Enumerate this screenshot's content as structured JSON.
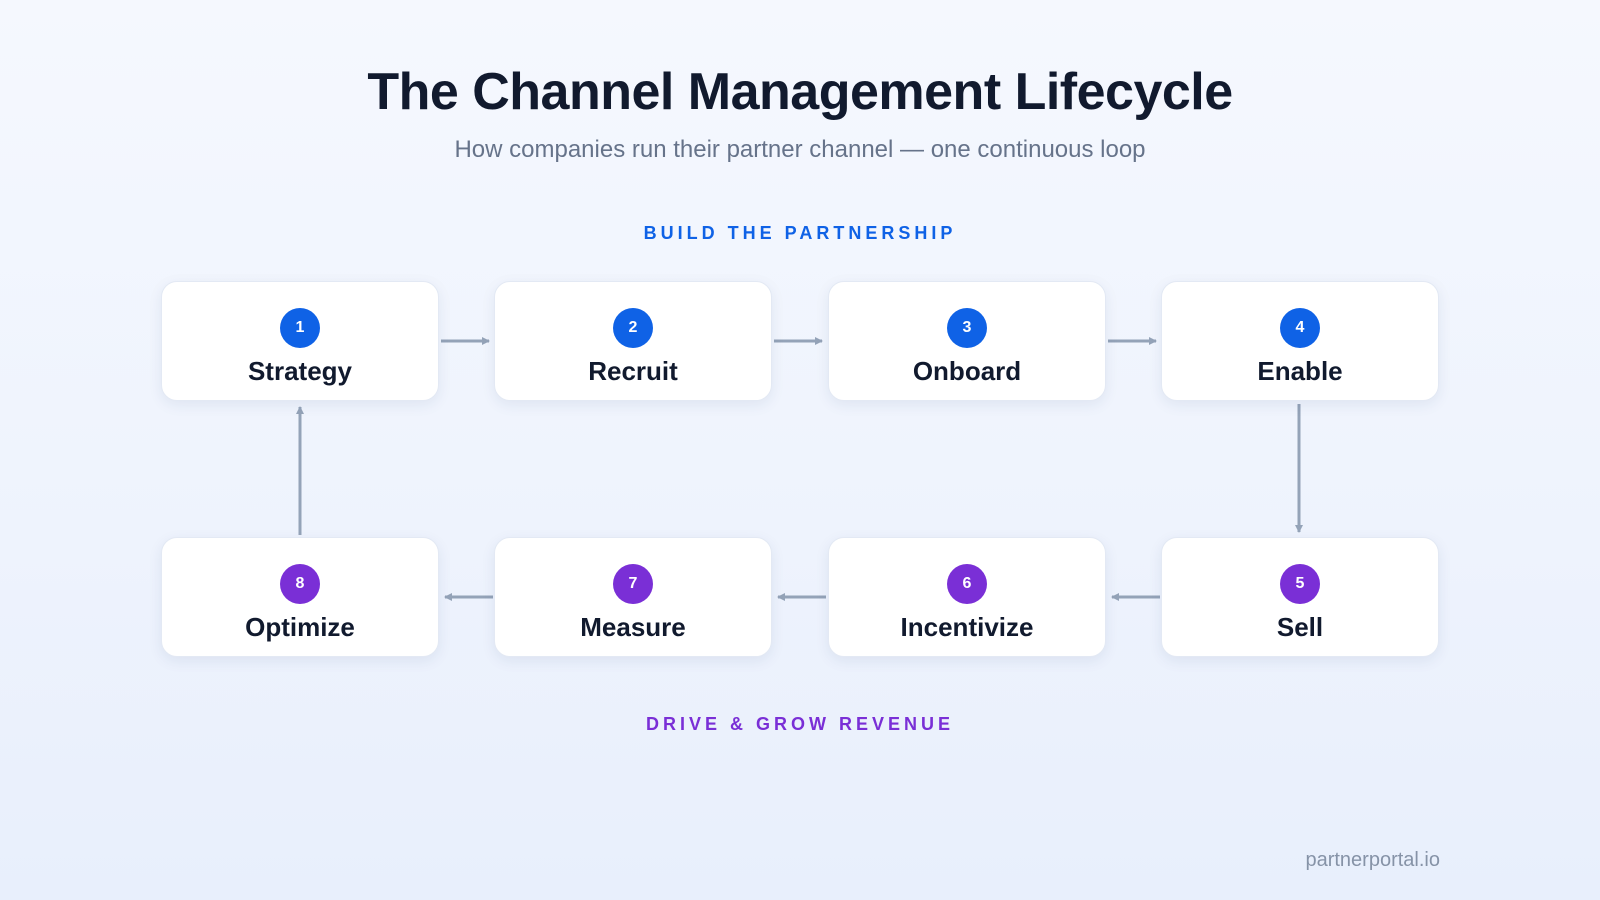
{
  "title": "The Channel Management Lifecycle",
  "subtitle": "How companies run their partner channel — one continuous loop",
  "phases": {
    "top": {
      "label": "BUILD THE PARTNERSHIP",
      "color": "#0f62e6"
    },
    "bottom": {
      "label": "DRIVE & GROW REVENUE",
      "color": "#7a2fd6"
    }
  },
  "steps": [
    {
      "number": "1",
      "name": "Strategy",
      "phase": "top"
    },
    {
      "number": "2",
      "name": "Recruit",
      "phase": "top"
    },
    {
      "number": "3",
      "name": "Onboard",
      "phase": "top"
    },
    {
      "number": "4",
      "name": "Enable",
      "phase": "top"
    },
    {
      "number": "5",
      "name": "Sell",
      "phase": "bottom"
    },
    {
      "number": "6",
      "name": "Incentivize",
      "phase": "bottom"
    },
    {
      "number": "7",
      "name": "Measure",
      "phase": "bottom"
    },
    {
      "number": "8",
      "name": "Optimize",
      "phase": "bottom"
    }
  ],
  "flow": [
    [
      "1",
      "2"
    ],
    [
      "2",
      "3"
    ],
    [
      "3",
      "4"
    ],
    [
      "4",
      "5"
    ],
    [
      "5",
      "6"
    ],
    [
      "6",
      "7"
    ],
    [
      "7",
      "8"
    ],
    [
      "8",
      "1"
    ]
  ],
  "colors": {
    "connector": "#94a3b8",
    "title": "#111a2e",
    "subtitle": "#66738a"
  },
  "footer": "partnerportal.io"
}
